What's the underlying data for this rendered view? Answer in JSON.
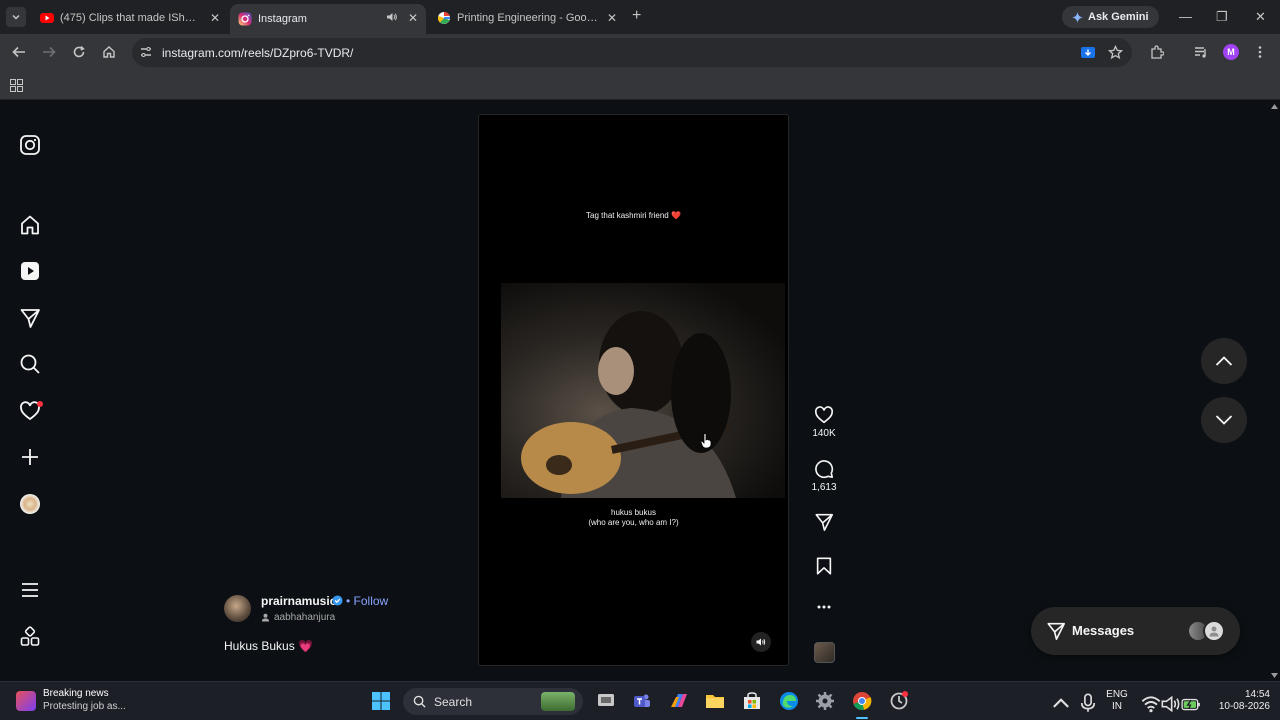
{
  "browser": {
    "tabs": [
      {
        "title": "(475) Clips that made IShowSpeed",
        "favicon": "youtube-icon",
        "active": false
      },
      {
        "title": "Instagram",
        "favicon": "instagram-icon",
        "active": true,
        "audio": true
      },
      {
        "title": "Printing Engineering - Google Search",
        "favicon": "google-icon",
        "active": false
      }
    ],
    "ask_gemini_label": "Ask Gemini",
    "url": "instagram.com/reels/DZpro6-TVDR/",
    "profile_initial": "M"
  },
  "sidebar": {
    "items": [
      "instagram-logo-icon",
      "home-icon",
      "reels-icon",
      "messages-icon",
      "search-icon",
      "notifications-icon",
      "create-icon",
      "profile-avatar",
      "more-icon",
      "also-from-meta-icon"
    ]
  },
  "reel": {
    "overlay_top": "Tag that kashmiri friend ❤️",
    "subtitle_line1": "hukus bukus",
    "subtitle_line2": "(who are you, who am I?)",
    "author": {
      "username": "prairnamusic",
      "follow_label": "Follow",
      "collaborator": "aabhahanjura"
    },
    "title": "Hukus Bukus",
    "title_emoji": "💗",
    "likes": "140K",
    "comments": "1,613"
  },
  "messages": {
    "label": "Messages"
  },
  "taskbar": {
    "news_headline": "Breaking news",
    "news_sub": "Protesting job as...",
    "search_placeholder": "Search",
    "lang_line1": "ENG",
    "lang_line2": "IN",
    "time": "14:54",
    "date": "10-08-2026"
  },
  "colors": {
    "page_bg": "#0c1014",
    "accent_follow": "#8aa4ff",
    "notification_dot": "#ff3040"
  }
}
